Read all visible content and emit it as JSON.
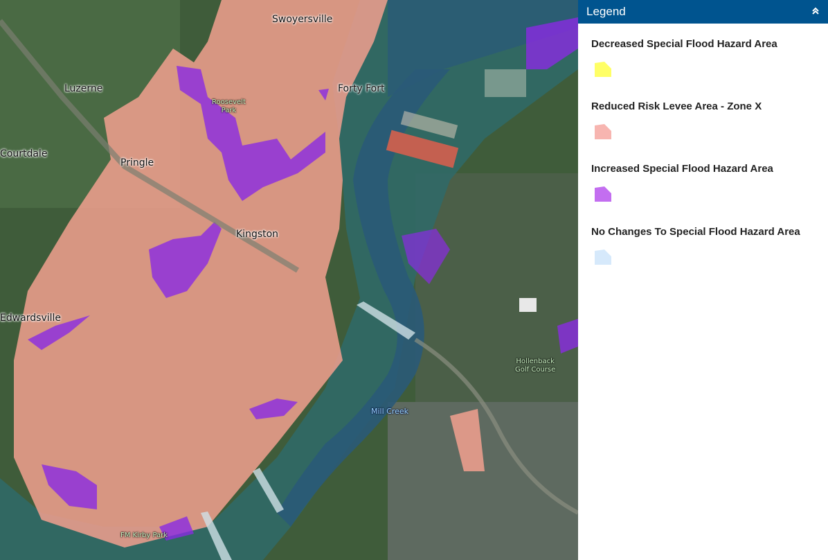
{
  "map": {
    "places": [
      "Swoyersville",
      "Luzerne",
      "Forty Fort",
      "Courtdale",
      "Pringle",
      "Kingston",
      "Edwardsville"
    ],
    "pois": [
      "Roosevelt\nPark",
      "Hollenback\nGolf Course",
      "FM Kirby Park"
    ],
    "water": [
      "Mill Creek"
    ]
  },
  "legend": {
    "title": "Legend",
    "collapse_icon": "double-chevron-up-icon",
    "items": [
      {
        "label": "Decreased Special Flood Hazard Area",
        "color": "#ffff66"
      },
      {
        "label": "Reduced Risk Levee Area - Zone X",
        "color": "#f7b5b0"
      },
      {
        "label": "Increased Special Flood Hazard Area",
        "color": "#c36ef0"
      },
      {
        "label": "No Changes To Special Flood Hazard Area",
        "color": "#d6e9fb"
      }
    ]
  }
}
